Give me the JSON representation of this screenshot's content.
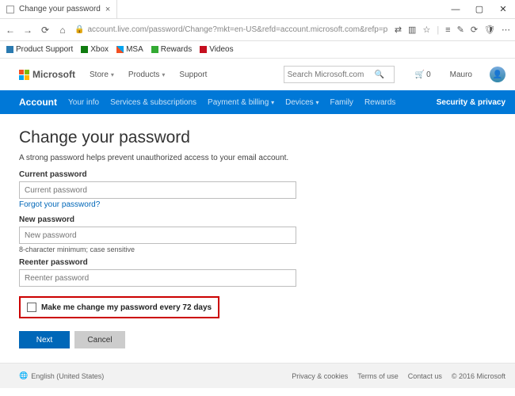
{
  "browser": {
    "tab_title": "Change your password",
    "url": "account.live.com/password/Change?mkt=en-US&refd=account.microsoft.com&refp=privacy",
    "favorites": [
      {
        "label": "Product Support",
        "icon": "sq-blue"
      },
      {
        "label": "Xbox",
        "icon": "sq-green"
      },
      {
        "label": "MSA",
        "icon": "sq-multi"
      },
      {
        "label": "Rewards",
        "icon": "sq-blue"
      },
      {
        "label": "Videos",
        "icon": "sq-red"
      }
    ]
  },
  "ms_header": {
    "brand": "Microsoft",
    "store": "Store",
    "products": "Products",
    "support": "Support",
    "search_placeholder": "Search Microsoft.com",
    "cart_count": "0",
    "user_name": "Mauro"
  },
  "nav": {
    "account": "Account",
    "your_info": "Your info",
    "services": "Services & subscriptions",
    "payment": "Payment & billing",
    "devices": "Devices",
    "family": "Family",
    "rewards": "Rewards",
    "security": "Security & privacy"
  },
  "page": {
    "title": "Change your password",
    "desc": "A strong password helps prevent unauthorized access to your email account.",
    "current_label": "Current password",
    "current_placeholder": "Current password",
    "forgot": "Forgot your password?",
    "new_label": "New password",
    "new_placeholder": "New password",
    "hint": "8-character minimum; case sensitive",
    "reenter_label": "Reenter password",
    "reenter_placeholder": "Reenter password",
    "checkbox": "Make me change my password every 72 days",
    "next": "Next",
    "cancel": "Cancel"
  },
  "footer": {
    "locale": "English (United States)",
    "privacy": "Privacy & cookies",
    "terms": "Terms of use",
    "contact": "Contact us",
    "copyright": "© 2016 Microsoft"
  }
}
